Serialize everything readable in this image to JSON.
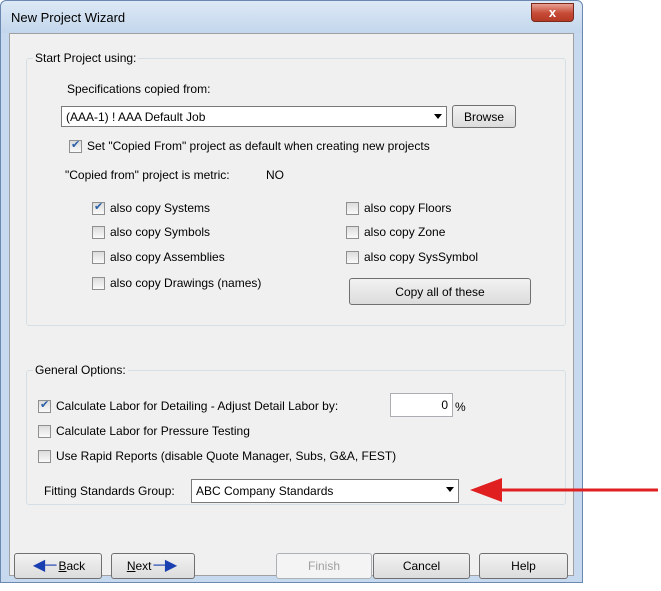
{
  "window": {
    "title": "New Project Wizard",
    "close_glyph": "x"
  },
  "start_group": {
    "label": "Start Project using:",
    "spec_label": "Specifications copied from:",
    "spec_value": "(AAA-1)  ! AAA Default Job",
    "browse_label": "Browse",
    "set_default_label": "Set \"Copied From\" project as default when creating new projects",
    "set_default_checked": true,
    "metric_label": "\"Copied from\" project is metric:",
    "metric_value": "NO",
    "copy_options": [
      {
        "label": "also copy Systems",
        "checked": true
      },
      {
        "label": "also copy Symbols",
        "checked": false
      },
      {
        "label": "also copy Assemblies",
        "checked": false
      },
      {
        "label": "also copy Drawings (names)",
        "checked": false
      },
      {
        "label": "also copy Floors",
        "checked": false
      },
      {
        "label": "also copy Zone",
        "checked": false
      },
      {
        "label": "also copy SysSymbol",
        "checked": false
      }
    ],
    "copy_all_label": "Copy all of these"
  },
  "general_group": {
    "label": "General Options:",
    "detail_label": "Calculate Labor for Detailing - Adjust Detail Labor by:",
    "detail_checked": true,
    "detail_value": "0",
    "detail_unit": "%",
    "pressure_label": "Calculate Labor for Pressure Testing",
    "pressure_checked": false,
    "rapid_label": "Use Rapid Reports (disable Quote Manager, Subs, G&A, FEST)",
    "rapid_checked": false,
    "fitting_label": "Fitting Standards Group:",
    "fitting_value": "ABC Company Standards"
  },
  "buttons": {
    "back_first": "B",
    "back_rest": "ack",
    "next_first": "N",
    "next_rest": "ext",
    "finish": "Finish",
    "cancel": "Cancel",
    "help": "Help"
  },
  "colors": {
    "annotation_arrow": "#e02020",
    "check_mark": "#2a5fa8"
  }
}
